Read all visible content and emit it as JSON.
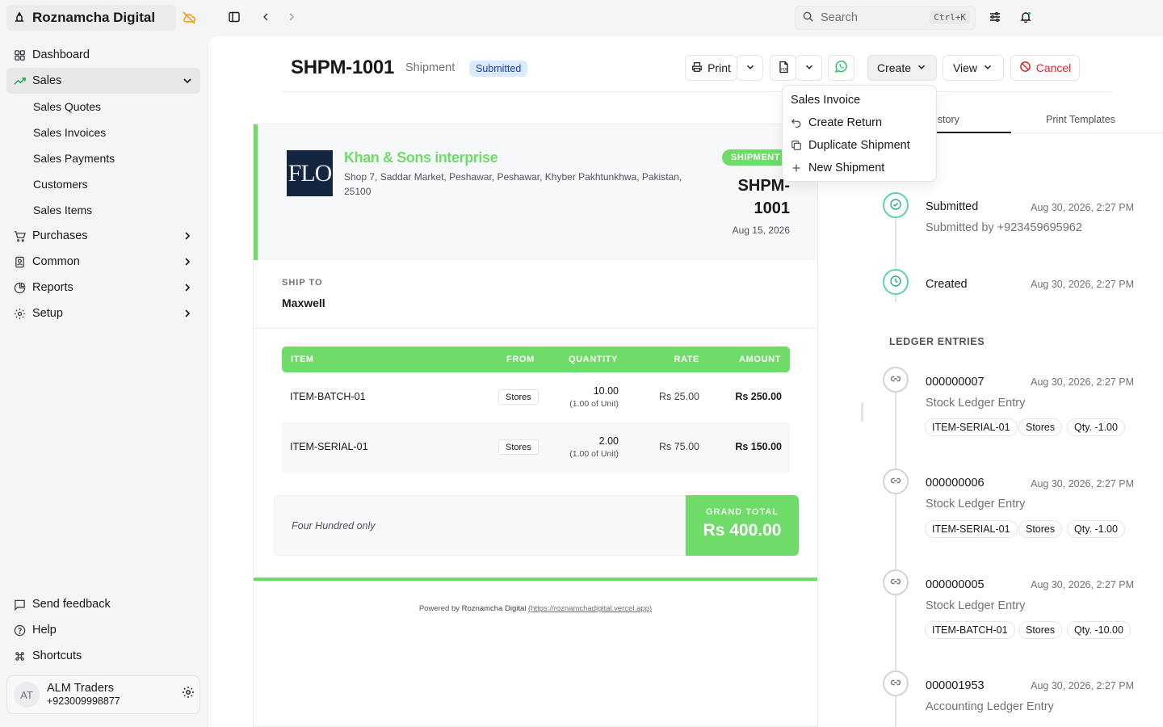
{
  "app": {
    "name": "Roznamcha Digital"
  },
  "sidebar": {
    "items": [
      {
        "label": "Dashboard"
      },
      {
        "label": "Sales"
      },
      {
        "label": "Purchases"
      },
      {
        "label": "Common"
      },
      {
        "label": "Reports"
      },
      {
        "label": "Setup"
      }
    ],
    "sales_sub": [
      "Sales Quotes",
      "Sales Invoices",
      "Sales Payments",
      "Customers",
      "Sales Items"
    ],
    "bottom": [
      "Send feedback",
      "Help",
      "Shortcuts"
    ],
    "user": {
      "initials": "AT",
      "name": "ALM Traders",
      "phone": "+923009998877"
    }
  },
  "topbar": {
    "search_placeholder": "Search",
    "search_shortcut": "Ctrl+K"
  },
  "header": {
    "title": "SHPM-1001",
    "doctype": "Shipment",
    "status": "Submitted",
    "buttons": {
      "print": "Print",
      "create": "Create",
      "view": "View",
      "cancel": "Cancel"
    }
  },
  "create_menu": [
    "Sales Invoice",
    "Create Return",
    "Duplicate Shipment",
    "New Shipment"
  ],
  "document": {
    "logo_text": "FLO",
    "company": "Khan & Sons interprise",
    "address_line1": "Shop 7, Saddar Market, Peshawar, Peshawar, Khyber Pakhtunkhwa, Pakistan,",
    "address_line2": "25100",
    "badge": "SHIPMENT",
    "number_line1": "SHPM-",
    "number_line2": "1001",
    "date": "Aug 15, 2026",
    "ship_to_label": "SHIP TO",
    "ship_to": "Maxwell",
    "columns": {
      "item": "ITEM",
      "from": "FROM",
      "quantity": "QUANTITY",
      "rate": "RATE",
      "amount": "AMOUNT"
    },
    "rows": [
      {
        "item": "ITEM-BATCH-01",
        "from": "Stores",
        "qty": "10.00",
        "qty_unit": "(1.00 of Unit)",
        "rate": "Rs 25.00",
        "amount": "Rs 250.00"
      },
      {
        "item": "ITEM-SERIAL-01",
        "from": "Stores",
        "qty": "2.00",
        "qty_unit": "(1.00 of Unit)",
        "rate": "Rs 75.00",
        "amount": "Rs 150.00"
      }
    ],
    "amount_in_words": "Four Hundred only",
    "grand_total_label": "GRAND TOTAL",
    "grand_total": "Rs 400.00",
    "powered_prefix": "Powered by ",
    "powered_brand": "Roznamcha Digital",
    "powered_url": "(https://roznamchadigital.vercel.app)"
  },
  "right_panel": {
    "tabs": [
      "istory",
      "Print Templates"
    ],
    "timeline": [
      {
        "title": "Submitted",
        "time": "Aug 30, 2026, 2:27 PM",
        "sub": "Submitted by +923459695962"
      },
      {
        "title": "Created",
        "time": "Aug 30, 2026, 2:27 PM"
      }
    ],
    "ledger_label": "LEDGER ENTRIES",
    "ledger": [
      {
        "id": "000000007",
        "time": "Aug 30, 2026, 2:27 PM",
        "type": "Stock Ledger Entry",
        "chips": [
          "ITEM-SERIAL-01",
          "Stores",
          "Qty. -1.00"
        ]
      },
      {
        "id": "000000006",
        "time": "Aug 30, 2026, 2:27 PM",
        "type": "Stock Ledger Entry",
        "chips": [
          "ITEM-SERIAL-01",
          "Stores",
          "Qty. -1.00"
        ]
      },
      {
        "id": "000000005",
        "time": "Aug 30, 2026, 2:27 PM",
        "type": "Stock Ledger Entry",
        "chips": [
          "ITEM-BATCH-01",
          "Stores",
          "Qty. -10.00"
        ]
      },
      {
        "id": "000001953",
        "time": "Aug 30, 2026, 2:27 PM",
        "type": "Accounting Ledger Entry"
      }
    ]
  },
  "colors": {
    "accent_green": "#6fdc6a",
    "status_blue": "#1e40af",
    "danger": "#dc2626"
  }
}
